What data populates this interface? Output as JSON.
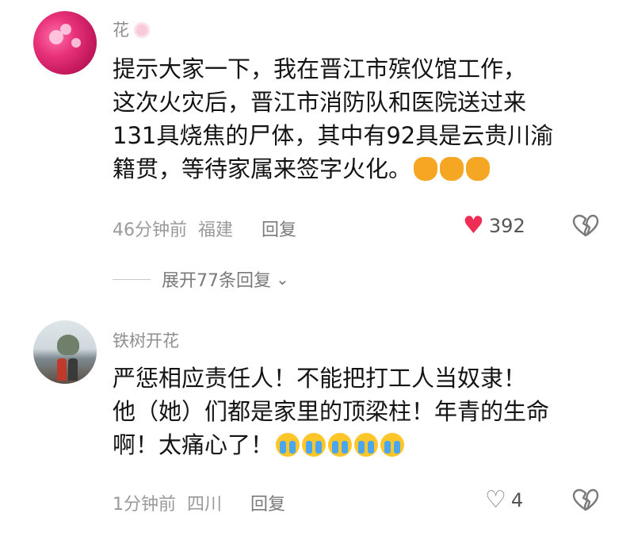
{
  "comments": [
    {
      "username": "花",
      "text_lines": [
        "提示大家一下，我在晋江市殡仪馆工作，",
        "这次火灾后，晋江市消防队和医院送过来",
        "131具烧焦的尸体，其中有92具是云贵川渝",
        "籍贯，等待家属来签字火化。"
      ],
      "emoji": [
        "pray",
        "pray",
        "pray"
      ],
      "time": "46分钟前",
      "location": "福建",
      "reply_label": "回复",
      "like_count": "392",
      "liked": true
    },
    {
      "username": "铁树开花",
      "text_lines": [
        "严惩相应责任人！不能把打工人当奴隶！",
        "他（她）们都是家里的顶梁柱！年青的生命",
        "啊！太痛心了！"
      ],
      "emoji": [
        "crying",
        "crying",
        "crying",
        "crying",
        "crying"
      ],
      "time": "1分钟前",
      "location": "四川",
      "reply_label": "回复",
      "like_count": "4",
      "liked": false
    }
  ],
  "expand_replies": "展开77条回复",
  "colors": {
    "like_active": "#ef2e55",
    "meta_text": "#9a9a9a"
  },
  "icons": [
    "avatar",
    "blossom-icon",
    "pray-emoji",
    "crying-emoji",
    "heart-icon",
    "dislike-icon",
    "chevron-down-icon"
  ]
}
